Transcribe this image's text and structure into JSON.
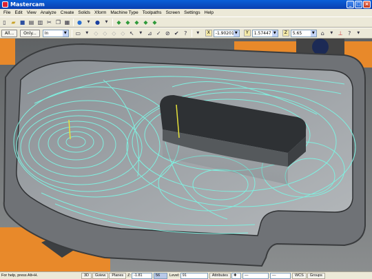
{
  "window": {
    "title": "Mastercam",
    "minimize": "_",
    "maximize": "□",
    "close": "×"
  },
  "menu": [
    "File",
    "Edit",
    "View",
    "Analyze",
    "Create",
    "Solids",
    "Xform",
    "Machine Type",
    "Toolpaths",
    "Screen",
    "Settings",
    "Help"
  ],
  "toolbar2": {
    "all_button": "All...",
    "only_button": "Only...",
    "units_value": "In",
    "x_label": "X",
    "x_value": "-1.90201",
    "y_label": "Y",
    "y_value": "1.57447",
    "z_label": "Z",
    "z_value": "5.65"
  },
  "status": {
    "help_text": "For help, press Alt+H.",
    "view_3d": "3D",
    "gview": "Gview",
    "planes": "Planes",
    "z_label": "Z:",
    "z_value": "-1.81",
    "color_value": "56",
    "level_label": "Level:",
    "level_value": "91",
    "attributes": "Attributes",
    "wcs": "WCS",
    "groups": "Groups"
  },
  "colors": {
    "toolpath": "#7ff0e0",
    "clamp": "#e8892a",
    "part": "#6f7276",
    "titlebar": "#0a4fc8"
  }
}
